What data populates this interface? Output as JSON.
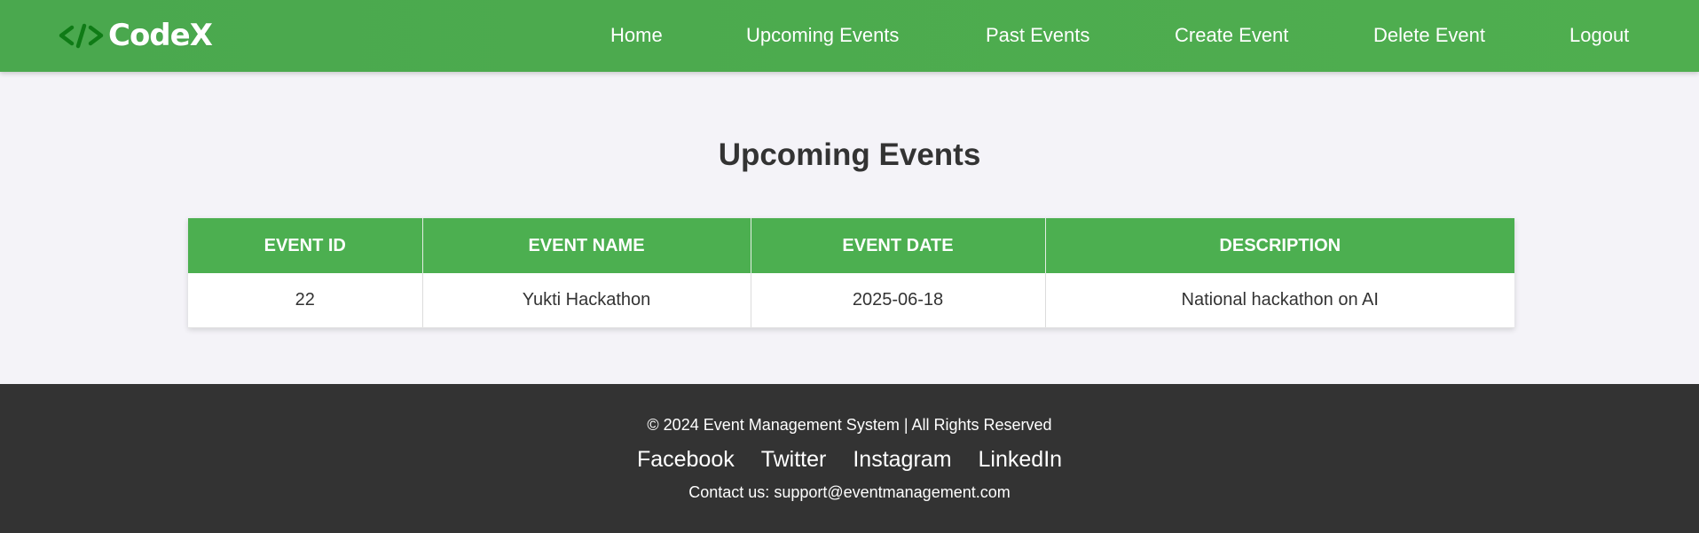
{
  "brand": {
    "name": "CodeX",
    "logo_icon": "code-brackets-icon",
    "icon_color": "#0f7b16"
  },
  "nav": {
    "items": [
      {
        "label": "Home"
      },
      {
        "label": "Upcoming Events"
      },
      {
        "label": "Past Events"
      },
      {
        "label": "Create Event"
      },
      {
        "label": "Delete Event"
      },
      {
        "label": "Logout"
      }
    ]
  },
  "page": {
    "title": "Upcoming Events"
  },
  "table": {
    "columns": [
      "EVENT ID",
      "EVENT NAME",
      "EVENT DATE",
      "DESCRIPTION"
    ],
    "rows": [
      [
        "22",
        "Yukti Hackathon",
        "2025-06-18",
        "National hackathon on AI"
      ]
    ]
  },
  "footer": {
    "copyright": "© 2024 Event Management System | All Rights Reserved",
    "social": [
      "Facebook",
      "Twitter",
      "Instagram",
      "LinkedIn"
    ],
    "contact": "Contact us: support@eventmanagement.com"
  },
  "colors": {
    "nav_bg": "#4caf50",
    "table_header_bg": "#4caf50",
    "footer_bg": "#333333",
    "page_bg": "#f4f3f8"
  }
}
